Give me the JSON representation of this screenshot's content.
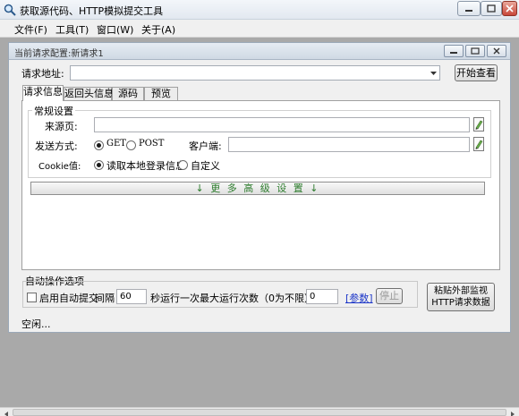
{
  "window": {
    "title": "获取源代码、HTTP模拟提交工具",
    "menus": [
      "文件(F)",
      "工具(T)",
      "窗口(W)",
      "关于(A)"
    ]
  },
  "child": {
    "title": "当前请求配置:新请求1"
  },
  "request": {
    "url_label": "请求地址:",
    "url_value": "",
    "start_button": "开始查看"
  },
  "tabs": [
    {
      "label": "请求信息",
      "active": true
    },
    {
      "label": "返回头信息",
      "active": false
    },
    {
      "label": "源码",
      "active": false
    },
    {
      "label": "预览",
      "active": false
    }
  ],
  "general": {
    "caption": "常规设置",
    "referer_label": "来源页:",
    "referer_value": "",
    "method_label": "发送方式:",
    "method_get": "GET",
    "method_post": "POST",
    "method_selected": "GET",
    "client_label": "客户端:",
    "client_value": "",
    "cookie_label": "Cookie值:",
    "cookie_option_local": "读取本地登录信息",
    "cookie_option_custom": "自定义",
    "cookie_selected": "读取本地登录信息"
  },
  "more_settings": "↓ 更 多 高 级 设 置 ↓",
  "auto": {
    "caption": "自动操作选项",
    "enable_label": "启用自动提交",
    "enabled": false,
    "interval_label": "间隔",
    "interval_value": "60",
    "per_label": "秒运行一次",
    "max_label": "最大运行次数（0为不限）:",
    "max_value": "0",
    "params_link": "[参数]",
    "stop_button": "停止",
    "paste_button_line1": "粘贴外部监视",
    "paste_button_line2": "HTTP请求数据"
  },
  "status": {
    "text": "空闲..."
  },
  "colors": {
    "mdi_background": "#a9a9a9",
    "accent_green": "#2b7a2b",
    "link_blue": "#1c36c8"
  }
}
